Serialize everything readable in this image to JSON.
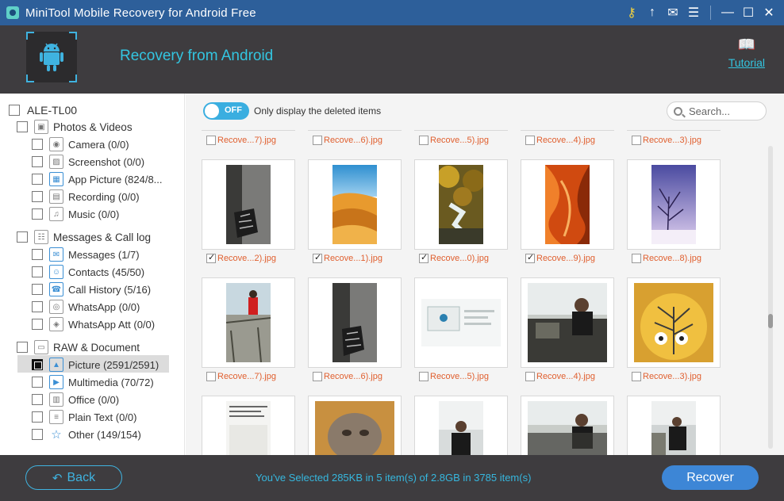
{
  "window": {
    "title": "MiniTool Mobile Recovery for Android Free",
    "controls": [
      "key-icon",
      "upgrade-arrow-icon",
      "mail-icon",
      "menu-icon",
      "minimize-icon",
      "maximize-icon",
      "close-icon"
    ]
  },
  "header": {
    "title": "Recovery from Android",
    "tutorial_label": "Tutorial",
    "accent": "#33c5e0"
  },
  "sidebar": {
    "device": "ALE-TL00",
    "groups": [
      {
        "label": "Photos & Videos",
        "items": [
          {
            "label": "Camera (0/0)",
            "icon": "camera-icon"
          },
          {
            "label": "Screenshot (0/0)",
            "icon": "screenshot-icon"
          },
          {
            "label": "App Picture (824/8...",
            "icon": "app-picture-icon"
          },
          {
            "label": "Recording (0/0)",
            "icon": "video-recording-icon"
          },
          {
            "label": "Music (0/0)",
            "icon": "music-icon"
          }
        ]
      },
      {
        "label": "Messages & Call log",
        "items": [
          {
            "label": "Messages (1/7)",
            "icon": "message-icon"
          },
          {
            "label": "Contacts (45/50)",
            "icon": "contacts-icon"
          },
          {
            "label": "Call History (5/16)",
            "icon": "call-history-icon"
          },
          {
            "label": "WhatsApp (0/0)",
            "icon": "whatsapp-icon"
          },
          {
            "label": "WhatsApp Att (0/0)",
            "icon": "whatsapp-attachment-icon"
          }
        ]
      },
      {
        "label": "RAW & Document",
        "items": [
          {
            "label": "Picture (2591/2591)",
            "icon": "picture-icon",
            "selected": true
          },
          {
            "label": "Multimedia (70/72)",
            "icon": "multimedia-icon"
          },
          {
            "label": "Office (0/0)",
            "icon": "office-icon"
          },
          {
            "label": "Plain Text (0/0)",
            "icon": "plain-text-icon"
          },
          {
            "label": "Other (149/154)",
            "icon": "star-icon"
          }
        ]
      }
    ]
  },
  "content": {
    "toggle_state": "OFF",
    "toggle_label": "Only display the deleted items",
    "search_placeholder": "Search...",
    "rows": [
      {
        "captions": [
          "Recove...7).jpg",
          "Recove...6).jpg",
          "Recove...5).jpg",
          "Recove...4).jpg",
          "Recove...3).jpg"
        ],
        "checked": [
          false,
          false,
          false,
          false,
          false
        ]
      },
      {
        "captions": [
          "Recove...2).jpg",
          "Recove...1).jpg",
          "Recove...0).jpg",
          "Recove...9).jpg",
          "Recove...8).jpg"
        ],
        "checked": [
          true,
          true,
          true,
          true,
          false
        ]
      },
      {
        "captions": [
          "Recove...7).jpg",
          "Recove...6).jpg",
          "Recove...5).jpg",
          "Recove...4).jpg",
          "Recove...3).jpg"
        ],
        "checked": [
          false,
          false,
          false,
          false,
          false
        ]
      }
    ]
  },
  "footer": {
    "back_label": "Back",
    "summary": "You've Selected 285KB in 5 item(s) of 2.8GB in 3785 item(s)",
    "recover_label": "Recover"
  }
}
